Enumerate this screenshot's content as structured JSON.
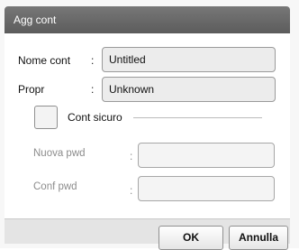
{
  "dialog": {
    "title": "Agg cont"
  },
  "form": {
    "name_label": "Nome cont",
    "name_value": "Untitled",
    "owner_label": "Propr",
    "owner_value": "Unknown",
    "secure_label": "Cont sicuro",
    "secure_checked": false,
    "new_pwd_label": "Nuova pwd",
    "new_pwd_value": "",
    "confirm_pwd_label": "Conf pwd",
    "confirm_pwd_value": "",
    "colon": ":"
  },
  "buttons": {
    "ok_label": "OK",
    "cancel_label": "Annulla"
  }
}
